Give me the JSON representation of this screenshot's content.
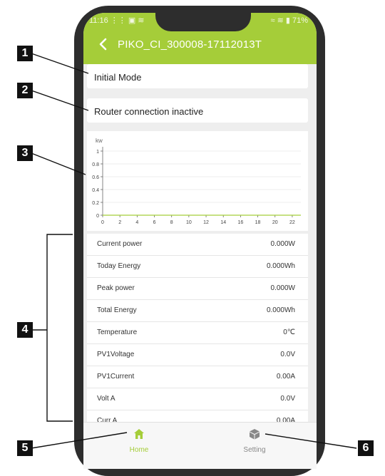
{
  "status_bar": {
    "time": "11:16",
    "left_icons": "⋮⋮ ▣ ≋",
    "battery": "71%",
    "right_icons": "≈ ≋ ▮"
  },
  "header": {
    "title": "PIKO_CI_300008-17112013T"
  },
  "cards": {
    "mode": "Initial Mode",
    "router": "Router connection inactive"
  },
  "chart_data": {
    "type": "line",
    "ylabel": "kw",
    "xlabel": "",
    "x": [
      0,
      2,
      4,
      6,
      8,
      10,
      12,
      14,
      16,
      18,
      20,
      22
    ],
    "y_ticks": [
      "1",
      "0.8",
      "0.6",
      "0.4",
      "0.2",
      "0"
    ],
    "ylim": [
      0,
      1
    ],
    "xlim": [
      0,
      23
    ],
    "series": [
      {
        "values": [
          0,
          0,
          0,
          0,
          0,
          0,
          0,
          0,
          0,
          0,
          0,
          0
        ]
      }
    ],
    "line_color": "#a5cd39",
    "grid": true
  },
  "table": [
    {
      "label": "Current power",
      "value": "0.000W"
    },
    {
      "label": "Today Energy",
      "value": "0.000Wh"
    },
    {
      "label": "Peak power",
      "value": "0.000W"
    },
    {
      "label": "Total Energy",
      "value": "0.000Wh"
    },
    {
      "label": "Temperature",
      "value": "0℃"
    },
    {
      "label": "PV1Voltage",
      "value": "0.0V"
    },
    {
      "label": "PV1Current",
      "value": "0.00A"
    },
    {
      "label": "Volt A",
      "value": "0.0V"
    },
    {
      "label": "Curr A",
      "value": "0.00A"
    }
  ],
  "nav": {
    "home": "Home",
    "setting": "Setting"
  },
  "callouts": [
    "1",
    "2",
    "3",
    "4",
    "5",
    "6"
  ],
  "colors": {
    "accent": "#a5cd39",
    "frame": "#2d2d2d"
  },
  "icons": {
    "back": "chevron-left-icon",
    "home": "home-icon",
    "setting": "cube-icon"
  }
}
